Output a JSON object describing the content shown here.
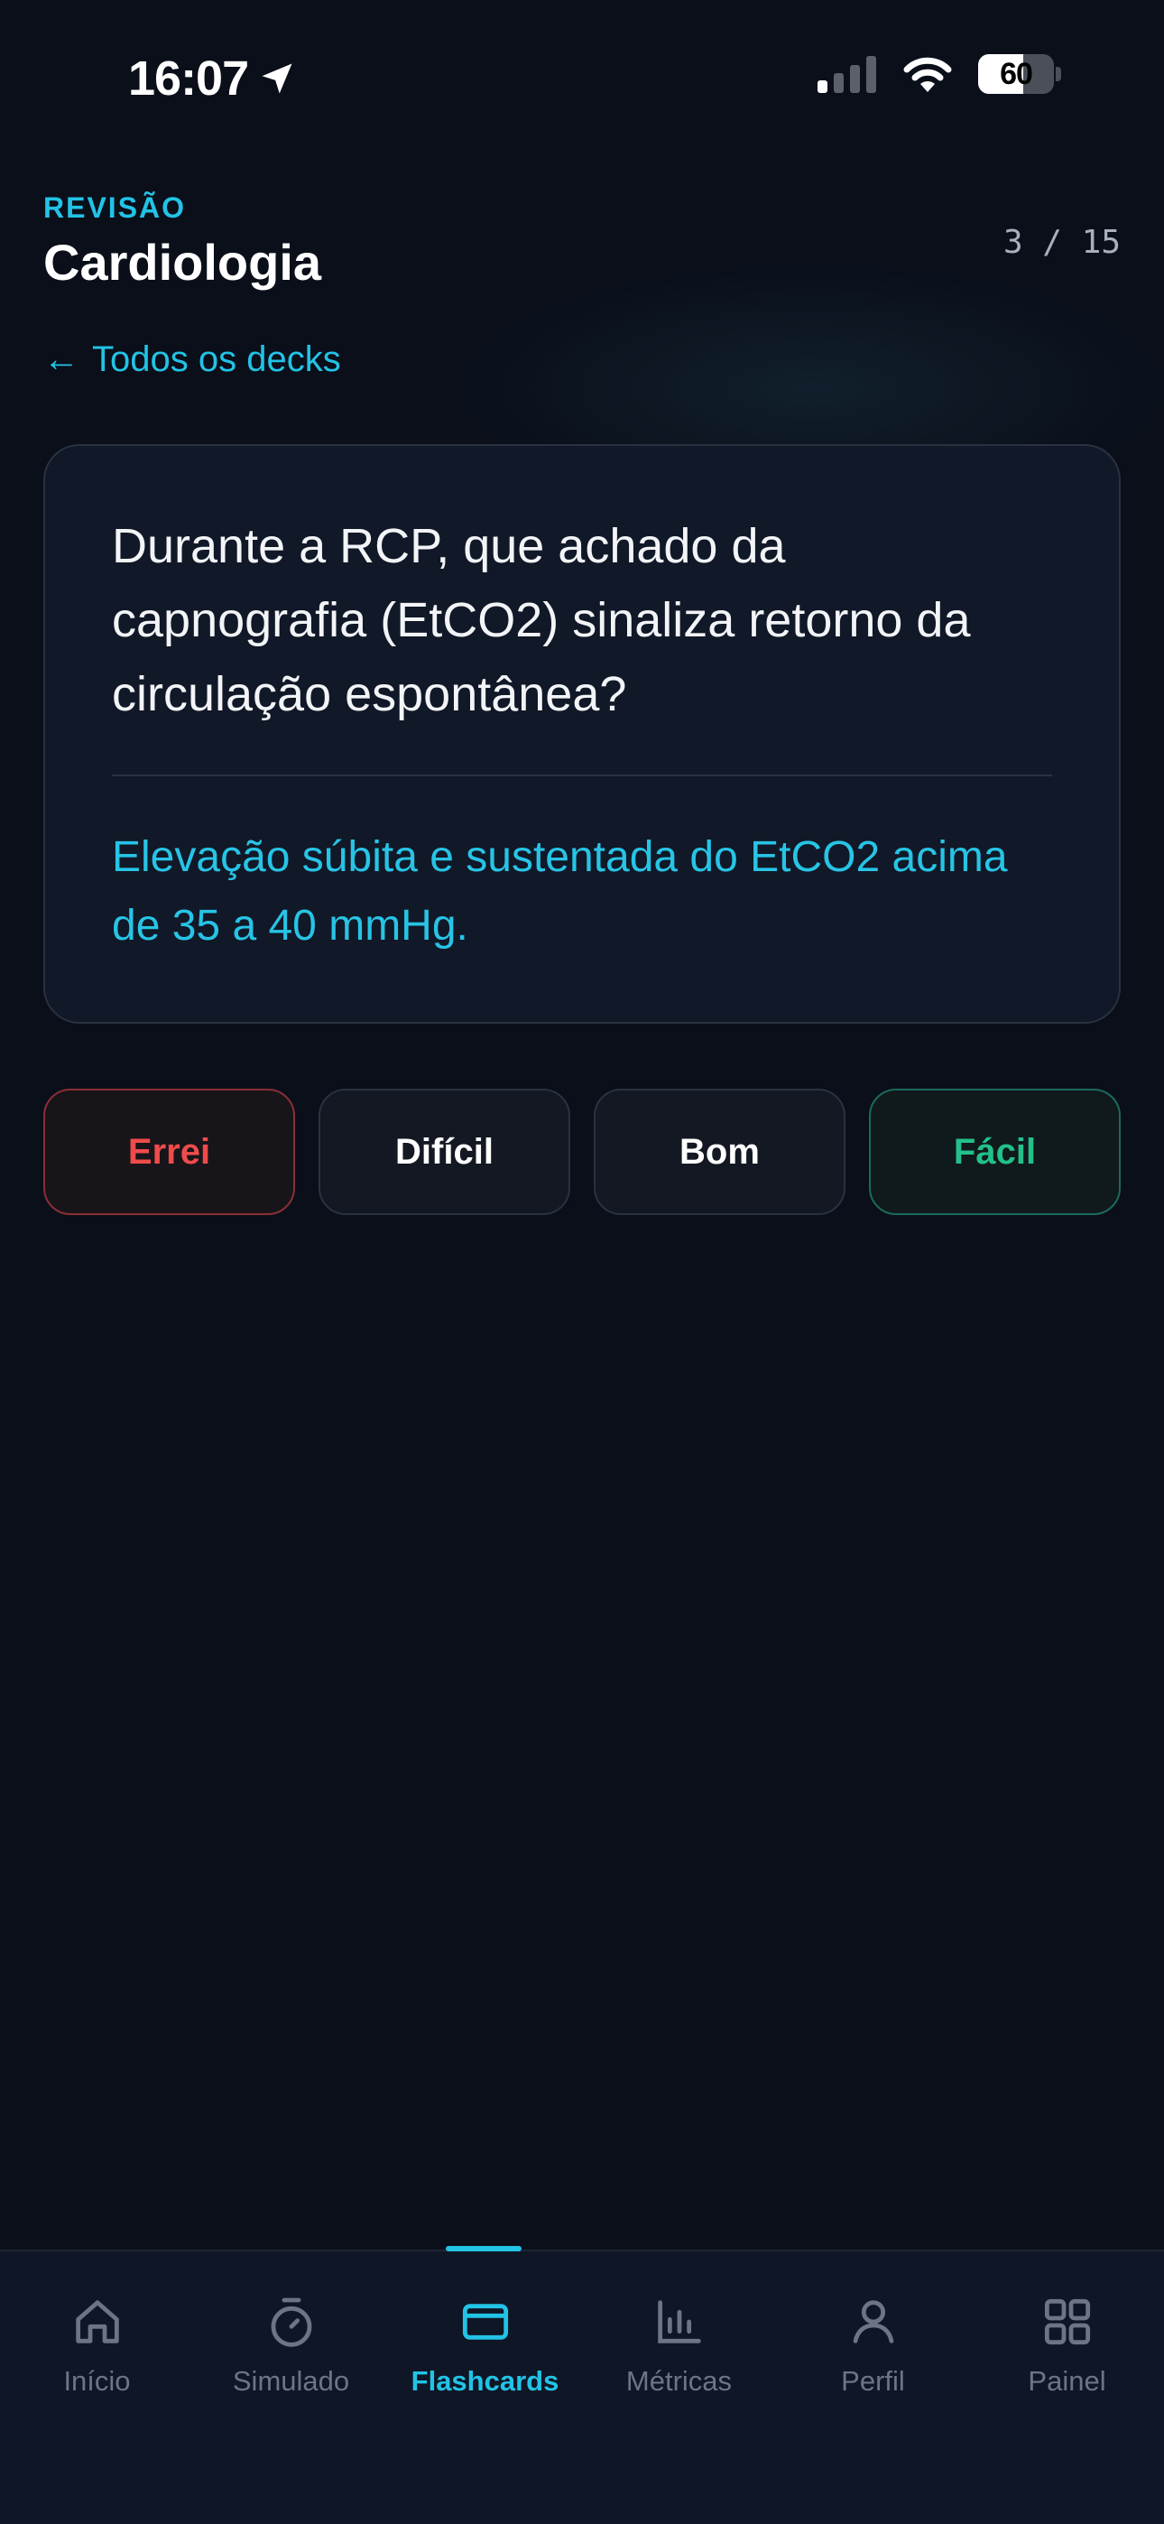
{
  "status_bar": {
    "time": "16:07",
    "battery": "60",
    "icons": [
      "location-arrow-icon",
      "signal-icon",
      "wifi-icon",
      "battery-icon"
    ]
  },
  "header": {
    "eyebrow": "REVISÃO",
    "title": "Cardiologia",
    "counter": "3 / 15",
    "back_arrow": "←",
    "back_label": "Todos os decks"
  },
  "card": {
    "question": "Durante a RCP, que achado da capnografia (EtCO2) sinaliza retorno da circulação espontânea?",
    "answer": "Elevação súbita e sustentada do EtCO2 acima de 35 a 40 mmHg."
  },
  "ratings": {
    "again": "Errei",
    "hard": "Difícil",
    "good": "Bom",
    "easy": "Fácil"
  },
  "tabbar": {
    "active": "Flashcards",
    "items": [
      {
        "label": "Início",
        "icon": "home-icon"
      },
      {
        "label": "Simulado",
        "icon": "timer-icon"
      },
      {
        "label": "Flashcards",
        "icon": "card-icon"
      },
      {
        "label": "Métricas",
        "icon": "bar-chart-icon"
      },
      {
        "label": "Perfil",
        "icon": "user-icon"
      },
      {
        "label": "Painel",
        "icon": "grid-icon"
      }
    ]
  },
  "colors": {
    "background": "#0a0f1a",
    "accent": "#22c3e6",
    "again": "#ef4b4b",
    "easy": "#22c08a",
    "card": "#111827"
  }
}
